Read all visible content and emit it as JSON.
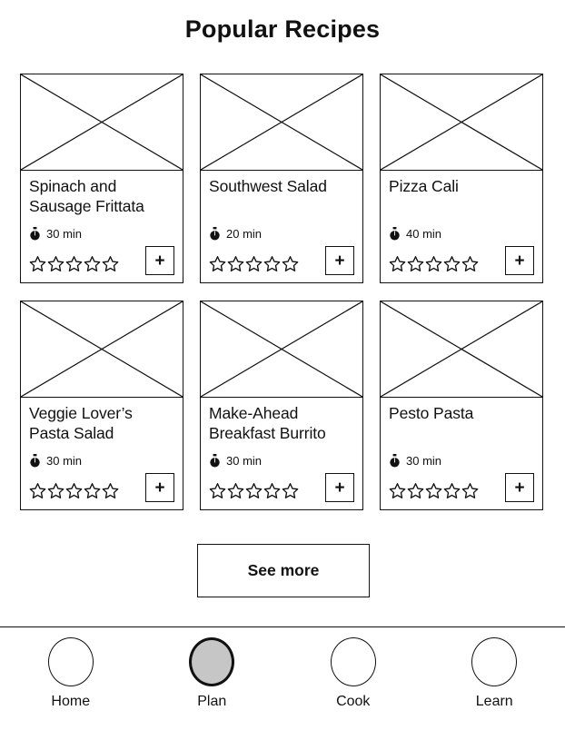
{
  "header": {
    "title": "Popular Recipes"
  },
  "icons": {
    "timer": "stopwatch-icon",
    "star": "star-outline-icon",
    "add": "+",
    "image_placeholder": "image-placeholder-icon"
  },
  "cards": [
    {
      "title": "Spinach and Sausage Frittata",
      "time": "30 min",
      "rating": 0,
      "max_rating": 5,
      "add_label": "+"
    },
    {
      "title": "Southwest Salad",
      "time": "20 min",
      "rating": 0,
      "max_rating": 5,
      "add_label": "+"
    },
    {
      "title": "Pizza Cali",
      "time": "40 min",
      "rating": 0,
      "max_rating": 5,
      "add_label": "+"
    },
    {
      "title": "Veggie Lover’s Pasta Salad",
      "time": "30 min",
      "rating": 0,
      "max_rating": 5,
      "add_label": "+"
    },
    {
      "title": "Make-Ahead Breakfast Burrito",
      "time": "30 min",
      "rating": 0,
      "max_rating": 5,
      "add_label": "+"
    },
    {
      "title": "Pesto Pasta",
      "time": "30 min",
      "rating": 0,
      "max_rating": 5,
      "add_label": "+"
    }
  ],
  "see_more": {
    "label": "See more"
  },
  "bottom_nav": {
    "active": "Plan",
    "items": [
      {
        "label": "Home",
        "active": false
      },
      {
        "label": "Plan",
        "active": true
      },
      {
        "label": "Cook",
        "active": false
      },
      {
        "label": "Learn",
        "active": false
      }
    ]
  },
  "colors": {
    "stroke": "#111111",
    "background": "#ffffff",
    "active_nav_fill": "#c6c6c6"
  }
}
